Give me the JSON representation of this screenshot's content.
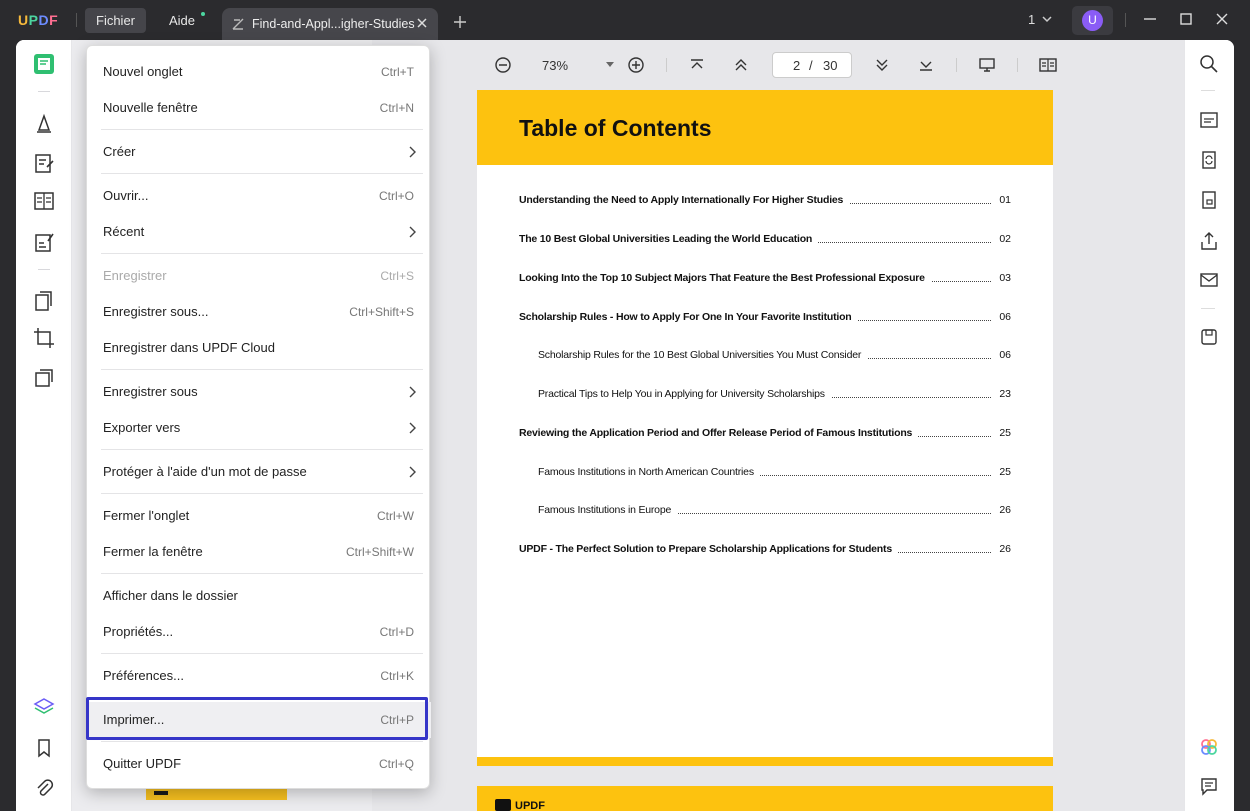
{
  "app": {
    "logo": [
      "U",
      "P",
      "D",
      "F"
    ],
    "menus": [
      "Fichier",
      "Aide"
    ],
    "tab_title": "Find-and-Appl...igher-Studies",
    "page_indicator": "1",
    "avatar_letter": "U"
  },
  "toolbar": {
    "zoom": "73%",
    "current_page": "2",
    "page_separator": "/",
    "total_pages": "30"
  },
  "menu": {
    "items": [
      {
        "label": "Nouvel onglet",
        "shortcut": "Ctrl+T"
      },
      {
        "label": "Nouvelle fenêtre",
        "shortcut": "Ctrl+N"
      },
      {
        "label": "Créer",
        "shortcut": ""
      },
      {
        "label": "Ouvrir...",
        "shortcut": "Ctrl+O"
      },
      {
        "label": "Récent",
        "shortcut": ""
      },
      {
        "label": "Enregistrer",
        "shortcut": "Ctrl+S"
      },
      {
        "label": "Enregistrer sous...",
        "shortcut": "Ctrl+Shift+S"
      },
      {
        "label": "Enregistrer dans UPDF Cloud",
        "shortcut": ""
      },
      {
        "label": "Enregistrer sous",
        "shortcut": ""
      },
      {
        "label": "Exporter vers",
        "shortcut": ""
      },
      {
        "label": "Protéger à l'aide d'un mot de passe",
        "shortcut": ""
      },
      {
        "label": "Fermer l'onglet",
        "shortcut": "Ctrl+W"
      },
      {
        "label": "Fermer la fenêtre",
        "shortcut": "Ctrl+Shift+W"
      },
      {
        "label": "Afficher dans le dossier",
        "shortcut": ""
      },
      {
        "label": "Propriétés...",
        "shortcut": "Ctrl+D"
      },
      {
        "label": "Préférences...",
        "shortcut": "Ctrl+K"
      },
      {
        "label": "Imprimer...",
        "shortcut": "Ctrl+P"
      },
      {
        "label": "Quitter UPDF",
        "shortcut": "Ctrl+Q"
      }
    ]
  },
  "document": {
    "toc_title": "Table of Contents",
    "entries": [
      {
        "title": "Understanding the Need to Apply Internationally For Higher Studies",
        "page": "01"
      },
      {
        "title": "The 10 Best Global Universities Leading the World Education",
        "page": "02"
      },
      {
        "title": "Looking Into the Top 10 Subject Majors That Feature the Best Professional Exposure",
        "page": "03"
      },
      {
        "title": "Scholarship Rules - How to Apply For One In Your Favorite Institution",
        "page": "06"
      },
      {
        "title": "Scholarship Rules for the 10 Best Global Universities You Must Consider",
        "page": "06"
      },
      {
        "title": "Practical Tips to Help You in Applying for University Scholarships",
        "page": "23"
      },
      {
        "title": "Reviewing the Application Period and Offer Release Period of Famous Institutions",
        "page": "25"
      },
      {
        "title": "Famous Institutions in North American Countries",
        "page": "25"
      },
      {
        "title": "Famous Institutions in Europe",
        "page": "26"
      },
      {
        "title": "UPDF - The Perfect Solution to Prepare Scholarship Applications for Students",
        "page": "26"
      }
    ],
    "next_page_logo": "UPDF"
  },
  "colors": {
    "accent_yellow": "#fdc20f",
    "highlight_border": "#3535c8",
    "avatar": "#8a5cf6"
  }
}
